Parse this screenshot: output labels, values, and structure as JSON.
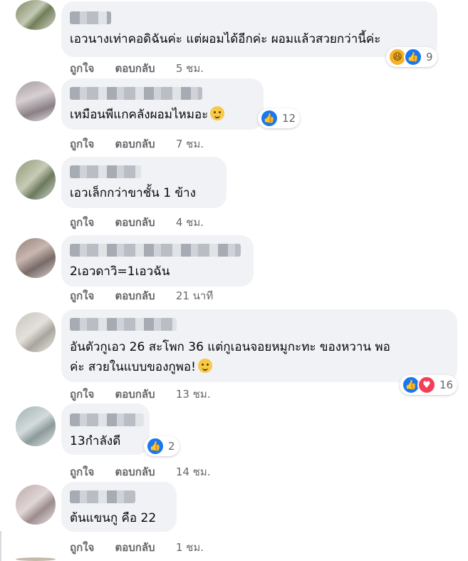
{
  "actions": {
    "like": "ถูกใจ",
    "reply": "ตอบกลับ"
  },
  "comments": [
    {
      "text": "เอวนางเท่าคอดิฉันค่ะ แต่ผอมได้อีกค่ะ ผอมแล้วสวยกว่านี้ค่ะ",
      "time": "5 ชม.",
      "reactions": {
        "icons": [
          "haha-icon",
          "like-icon"
        ],
        "count": "9"
      }
    },
    {
      "text": "เหมือนพีแกคลังผอมไหมอะ",
      "time": "7 ชม.",
      "reactions": {
        "icons": [
          "like-icon"
        ],
        "count": "12"
      }
    },
    {
      "text": "เอวเล็กกว่าขาชั้น 1 ข้าง",
      "time": "4 ชม."
    },
    {
      "text": "2เอวดาวิ=1เอวฉัน",
      "time": "21 นาที"
    },
    {
      "text_line1": "อันตัวกูเอว 26 สะโพก 36 แต่กูเอนจอยหมูกะทะ ของหวาน พอ",
      "text_line2": "ค่ะ สวยในแบบของกูพอ!",
      "time": "13 ชม.",
      "reactions": {
        "icons": [
          "like-icon",
          "love-icon"
        ],
        "count": "16"
      }
    },
    {
      "text": "13กำลังดี",
      "time": "14 ชม.",
      "reactions": {
        "icons": [
          "like-icon"
        ],
        "count": "2"
      }
    },
    {
      "text": "ต้นแขนกู คือ 22",
      "time": "1 ชม."
    }
  ]
}
